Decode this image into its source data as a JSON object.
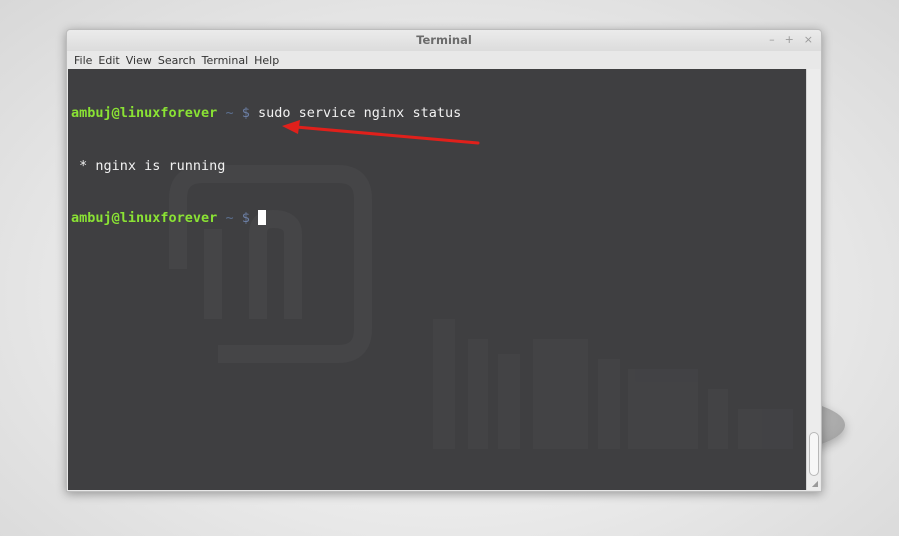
{
  "window": {
    "title": "Terminal",
    "controls": {
      "minimize": "–",
      "maximize": "+",
      "close": "×"
    }
  },
  "menu": {
    "items": [
      "File",
      "Edit",
      "View",
      "Search",
      "Terminal",
      "Help"
    ]
  },
  "terminal": {
    "lines": [
      {
        "user_host": "ambuj@linuxforever",
        "path": "~",
        "symbol": "$",
        "command": "sudo service nginx status"
      },
      {
        "output": " * nginx is running"
      },
      {
        "user_host": "ambuj@linuxforever",
        "path": "~",
        "symbol": "$",
        "command": ""
      }
    ],
    "annotation": {
      "type": "red-arrow",
      "color": "#e0201b",
      "points_to": "nginx is running"
    }
  },
  "colors": {
    "terminal_bg": "#3f3f41",
    "prompt_user": "#8ae234",
    "prompt_symbol": "#6c7fa5",
    "text": "#f2f2f2"
  }
}
